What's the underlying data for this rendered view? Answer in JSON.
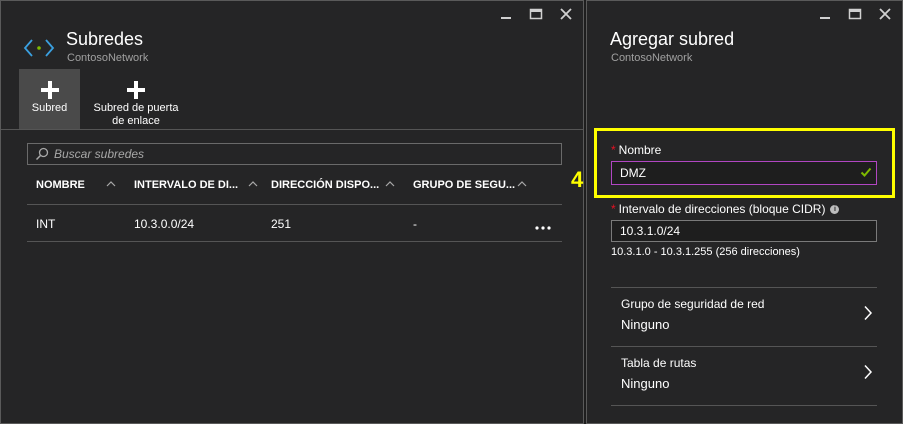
{
  "left_blade": {
    "title": "Subredes",
    "subtitle": "ContosoNetwork",
    "commands": [
      {
        "label": "Subred"
      },
      {
        "label": "Subred de puerta de enlace"
      }
    ],
    "search": {
      "placeholder": "Buscar subredes"
    },
    "table": {
      "columns": [
        "NOMBRE",
        "INTERVALO DE DI...",
        "DIRECCIÓN DISPO...",
        "GRUPO DE SEGU..."
      ],
      "rows": [
        {
          "cells": [
            "INT",
            "10.3.0.0/24",
            "251",
            "-"
          ]
        }
      ]
    }
  },
  "right_blade": {
    "title": "Agregar subred",
    "subtitle": "ContosoNetwork",
    "step_number": "4",
    "required_mark": "*",
    "name_field": {
      "label": "Nombre",
      "value": "DMZ"
    },
    "cidr_field": {
      "label": "Intervalo de direcciones (bloque CIDR)",
      "info": "i",
      "value": "10.3.1.0/24",
      "hint": "10.3.1.0 - 10.3.1.255 (256 direcciones)"
    },
    "nsg": {
      "label": "Grupo de seguridad de red",
      "value": "Ninguno"
    },
    "route_table": {
      "label": "Tabla de rutas",
      "value": "Ninguno"
    }
  },
  "colors": {
    "background": "#252526",
    "highlight": "#ffff00",
    "required": "#e81123",
    "input_focus": "#b146c2",
    "check": "#7fba00"
  }
}
